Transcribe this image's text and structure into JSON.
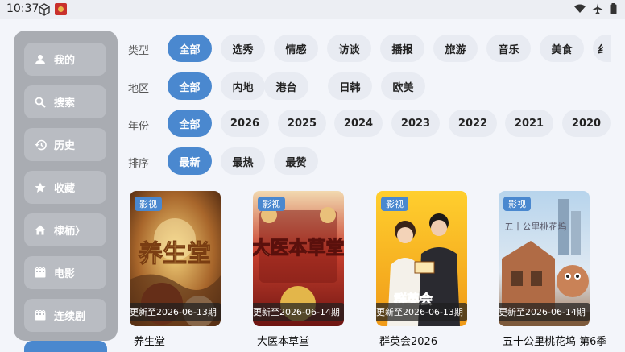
{
  "status": {
    "time": "10:37"
  },
  "sidebar": {
    "items": [
      {
        "label": "我的",
        "icon": "person-icon"
      },
      {
        "label": "搜索",
        "icon": "search-icon"
      },
      {
        "label": "历史",
        "icon": "history-icon"
      },
      {
        "label": "收藏",
        "icon": "star-icon"
      },
      {
        "label": "棣栭〉",
        "icon": "home-icon"
      },
      {
        "label": "电影",
        "icon": "movie-icon"
      },
      {
        "label": "连续剧",
        "icon": "tv-icon"
      }
    ]
  },
  "filters": {
    "type": {
      "label": "类型",
      "options": [
        "全部",
        "选秀",
        "情感",
        "访谈",
        "播报",
        "旅游",
        "音乐",
        "美食",
        "纟"
      ],
      "selected": "全部"
    },
    "region": {
      "label": "地区",
      "options": [
        "全部",
        "内地",
        "港台",
        "日韩",
        "欧美"
      ],
      "selected": "全部"
    },
    "year": {
      "label": "年份",
      "options": [
        "全部",
        "2026",
        "2025",
        "2024",
        "2023",
        "2022",
        "2021",
        "2020"
      ],
      "selected": "全部"
    },
    "sort": {
      "label": "排序",
      "options": [
        "最新",
        "最热",
        "最赞"
      ],
      "selected": "最新"
    }
  },
  "cards": [
    {
      "tag": "影视",
      "update": "更新至2026-06-13期",
      "title": "养生堂",
      "poster_text": "养生堂"
    },
    {
      "tag": "影视",
      "update": "更新至2026-06-14期",
      "title": "大医本草堂",
      "poster_text": "大医本草堂"
    },
    {
      "tag": "影视",
      "update": "更新至2026-06-13期",
      "title": "群英会2026",
      "poster_text": "群英会"
    },
    {
      "tag": "影视",
      "update": "更新至2026-06-14期",
      "title": "五十公里桃花坞 第6季",
      "poster_text": "五十公里桃花坞"
    }
  ]
}
